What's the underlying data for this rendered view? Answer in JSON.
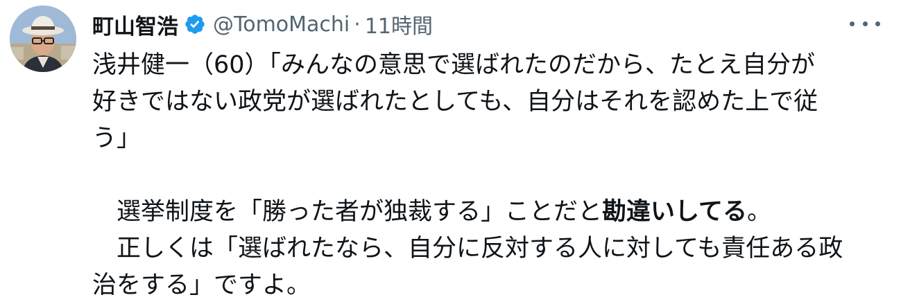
{
  "tweet": {
    "display_name": "町山智浩",
    "handle": "@TomoMachi",
    "separator": "·",
    "timestamp": "11時間",
    "verified_icon": "verified-badge-icon",
    "more_icon": "more-dots-icon",
    "colors": {
      "verified": "#1d9bf0",
      "secondary_text": "#536471",
      "primary_text": "#0f1419"
    },
    "body": {
      "line1": "浅井健一（60）「みんなの意思で選ばれたのだから、たとえ自分が",
      "line2": "好きではない政党が選ばれたとしても、自分はそれを認めた上で従",
      "line3": "う」",
      "line4_pre": "選挙制度を「勝った者が独裁する」ことだと",
      "line4_bold": "勘違いしてる",
      "line4_post": "。",
      "line5": "正しくは「選ばれたなら、自分に反対する人に対しても責任ある政",
      "line6": "治をする」ですよ。"
    }
  }
}
